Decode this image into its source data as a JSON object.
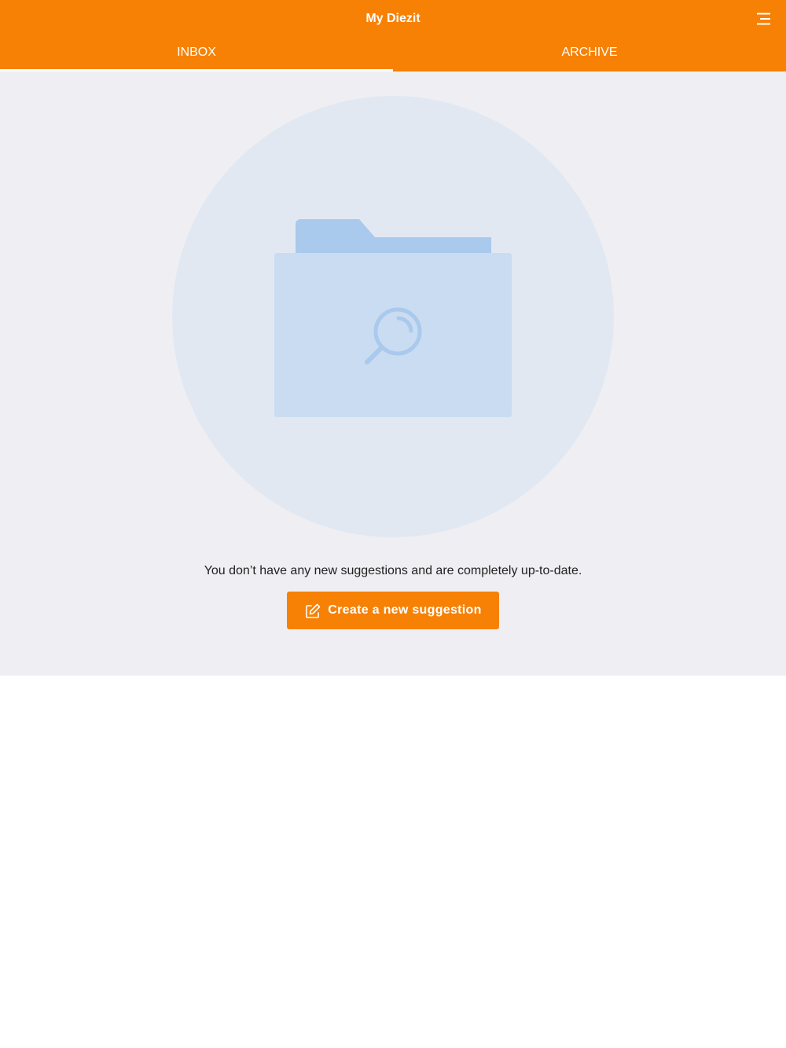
{
  "header": {
    "title": "My Diezit",
    "menu_icon": "menu-icon"
  },
  "tabs": [
    {
      "label": "INBOX",
      "active": true
    },
    {
      "label": "ARCHIVE",
      "active": false
    }
  ],
  "empty_state": {
    "illustration_icon": "folder-search-icon",
    "message": "You don’t have any new suggestions and are completely up-to-date.",
    "button_label": "Create a new suggestion",
    "button_icon": "edit-icon"
  },
  "colors": {
    "brand": "#f78104",
    "background": "#efeff3",
    "illustration_circle": "#e2e8f2",
    "folder_front": "#cadcf1",
    "folder_back": "#a9c9ed"
  }
}
